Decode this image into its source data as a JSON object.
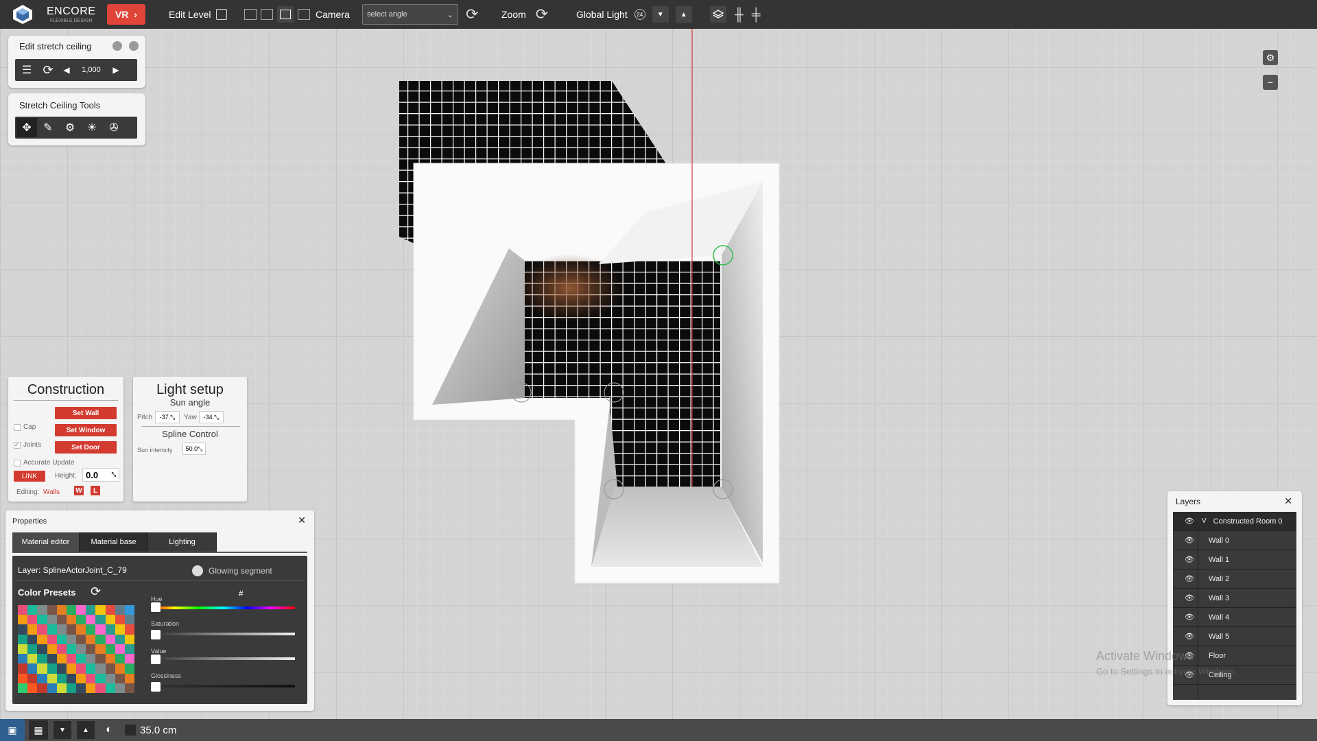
{
  "app": {
    "brand": "ENCORE",
    "brand_sub": "FLEXIBLE DESIGN",
    "vr_label": "VR"
  },
  "toolbar": {
    "edit_level": "Edit Level",
    "camera": "Camera",
    "angle_placeholder": "select angle",
    "zoom": "Zoom",
    "global_light": "Global Light",
    "global_light_badge": "24"
  },
  "edit_stretch": {
    "title": "Edit stretch ceiling",
    "value": "1,000"
  },
  "stretch_tools": {
    "title": "Stretch Ceiling Tools"
  },
  "construction": {
    "title": "Construction",
    "set_wall": "Set Wall",
    "set_window": "Set Window",
    "set_door": "Set Door",
    "cap": "Cap",
    "joints": "Joints",
    "accurate_update": "Accurate Update",
    "link": "LINK",
    "height_label": "Height:",
    "height_value": "0.0",
    "editing_label": "Editing:",
    "editing_value": "Walls",
    "w": "W",
    "l": "L"
  },
  "light_setup": {
    "title": "Light setup",
    "sun_angle": "Sun angle",
    "pitch_label": "Pitch",
    "pitch_value": "-37.",
    "yaw_label": "Yaw",
    "yaw_value": "-34.",
    "spline_control": "Spline Control",
    "sun_intensity_label": "Sun intensity",
    "sun_intensity_value": "50.0"
  },
  "properties": {
    "title": "Properties",
    "tabs": [
      "Material editor",
      "Material base",
      "Lighting"
    ],
    "layer_label": "Layer: SplineActorJoint_C_79",
    "glowing": "Glowing segment",
    "color_presets": "Color Presets",
    "hash": "#",
    "hue": "Hue",
    "saturation": "Saturation",
    "value": "Value",
    "glossiness": "Glossiness"
  },
  "layers": {
    "title": "Layers",
    "root": "Constructed Room 0",
    "items": [
      "Wall 0",
      "Wall 1",
      "Wall 2",
      "Wall 3",
      "Wall 4",
      "Wall 5",
      "Floor",
      "Ceiling"
    ]
  },
  "watermark": {
    "line1": "Activate Windows",
    "line2": "Go to Settings to activate Windows."
  },
  "statusbar": {
    "measure": "35.0 cm"
  },
  "colors": {
    "accent_red": "#d33b30",
    "toolbar": "#343434",
    "panel": "#f4f4f4"
  }
}
